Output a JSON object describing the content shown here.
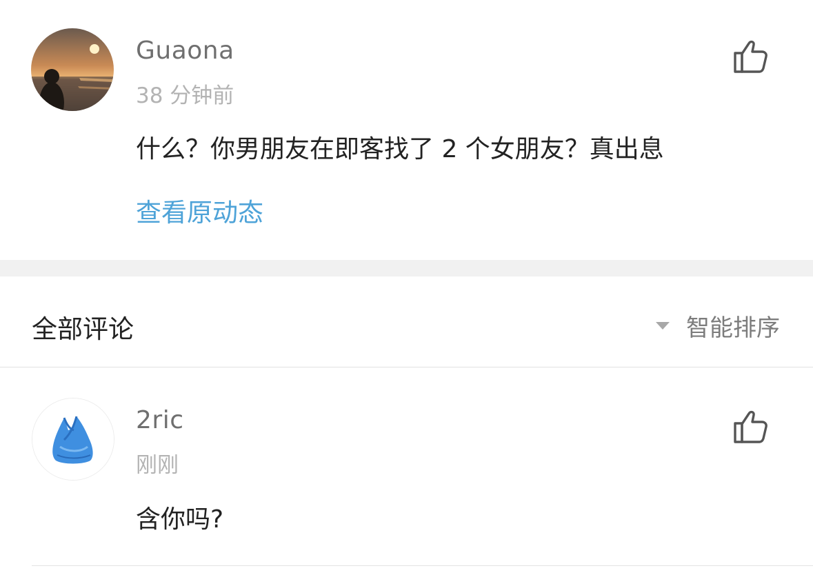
{
  "post": {
    "username": "Guaona",
    "timestamp": "38 分钟前",
    "content": "什么？你男朋友在即客找了 2 个女朋友？真出息",
    "view_original_label": "查看原动态",
    "avatar": "sunset-silhouette-avatar",
    "like_icon": "thumbs-up-icon"
  },
  "comments_section": {
    "title": "全部评论",
    "sort_label": "智能排序",
    "sort_icon": "triangle-down-icon"
  },
  "comments": [
    {
      "username": "2ric",
      "timestamp": "刚刚",
      "content": "含你吗?",
      "avatar": "blue-plastic-bag-avatar",
      "like_icon": "thumbs-up-icon"
    }
  ],
  "colors": {
    "link": "#4ea3d8",
    "username": "#6f6f6f",
    "timestamp": "#b3b3b3",
    "band": "#f1f1f1"
  }
}
